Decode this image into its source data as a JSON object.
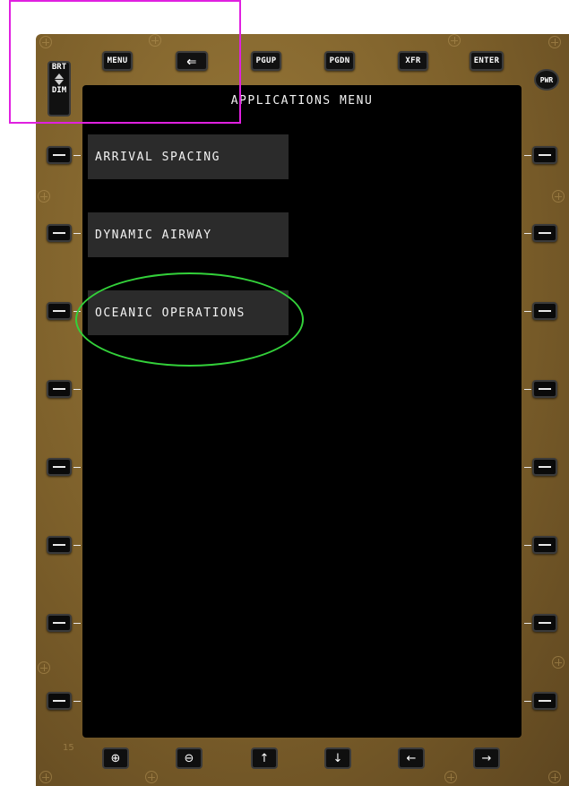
{
  "top_keys": {
    "menu": "MENU",
    "back": "⇐",
    "pgup": "PGUP",
    "pgdn": "PGDN",
    "xfr": "XFR",
    "enter": "ENTER"
  },
  "brightness": {
    "brt": "BRT",
    "dim": "DIM"
  },
  "power": "PWR",
  "screen": {
    "title": "APPLICATIONS MENU",
    "items": [
      {
        "label": "ARRIVAL SPACING"
      },
      {
        "label": "DYNAMIC AIRWAY"
      },
      {
        "label": "OCEANIC OPERATIONS"
      }
    ]
  },
  "bottom_keys": {
    "zoom_in": "⊕",
    "zoom_out": "⊖",
    "up": "↑",
    "down": "↓",
    "left": "←",
    "right": "→"
  },
  "bezel_number": "15",
  "colors": {
    "bezel": "#7c5f2a",
    "screen": "#000000",
    "menu_item_bg": "#2b2b2b",
    "highlight_rect": "#e020e0",
    "highlight_ellipse": "#33d13a"
  }
}
